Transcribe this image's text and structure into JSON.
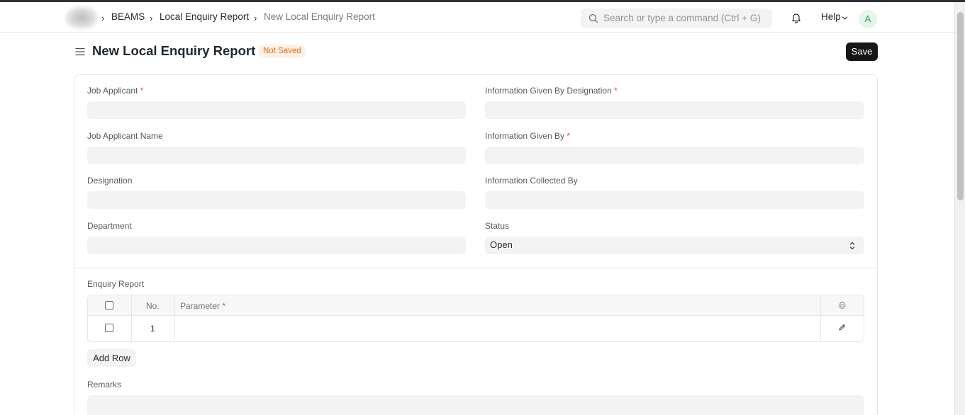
{
  "breadcrumb": {
    "items": [
      "BEAMS",
      "Local Enquiry Report",
      "New Local Enquiry Report"
    ]
  },
  "search": {
    "placeholder": "Search or type a command (Ctrl + G)"
  },
  "navbar": {
    "help_label": "Help",
    "avatar_initial": "A"
  },
  "page": {
    "title": "New Local Enquiry Report",
    "status_badge": "Not Saved",
    "save_label": "Save"
  },
  "form": {
    "job_applicant_label": "Job Applicant",
    "job_applicant_name_label": "Job Applicant Name",
    "designation_label": "Designation",
    "department_label": "Department",
    "info_given_by_designation_label": "Information Given By Designation",
    "info_given_by_label": "Information Given By",
    "info_collected_by_label": "Information Collected By",
    "status_label": "Status",
    "status_value": "Open",
    "required_mark": "*"
  },
  "enquiry_table": {
    "section_label": "Enquiry Report",
    "columns": {
      "no": "No.",
      "parameter": "Parameter"
    },
    "rows": [
      {
        "no": "1",
        "parameter": ""
      }
    ],
    "add_row_label": "Add Row"
  },
  "remarks": {
    "label": "Remarks"
  },
  "colors": {
    "badge_bg": "#fff1e7",
    "badge_text": "#e86c13",
    "primary_button": "#171717",
    "required": "#e24c4c",
    "avatar_bg": "#e4f5e9",
    "avatar_text": "#2f9d58"
  }
}
